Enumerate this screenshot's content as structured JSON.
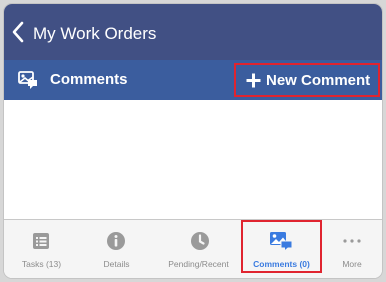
{
  "nav": {
    "title": "My Work Orders",
    "back_icon": "chevron-left-icon"
  },
  "toolbar": {
    "section_label": "Comments",
    "section_icon": "image-comment-icon",
    "new_comment_label": "New Comment",
    "new_comment_icon": "plus-icon"
  },
  "tabs": [
    {
      "label": "Tasks (13)",
      "icon": "list-icon",
      "selected": false
    },
    {
      "label": "Details",
      "icon": "info-icon",
      "selected": false
    },
    {
      "label": "Pending/Recent",
      "icon": "clock-icon",
      "selected": false
    },
    {
      "label": "Comments (0)",
      "icon": "image-comment-icon",
      "selected": true
    },
    {
      "label": "More",
      "icon": "more-dots-icon",
      "selected": false
    }
  ],
  "colors": {
    "nav_bar": "#415084",
    "toolbar": "#3b5d9e",
    "highlight_outline": "#e0242f",
    "tab_active": "#3a7be0",
    "tab_inactive": "#8c8c8c"
  }
}
